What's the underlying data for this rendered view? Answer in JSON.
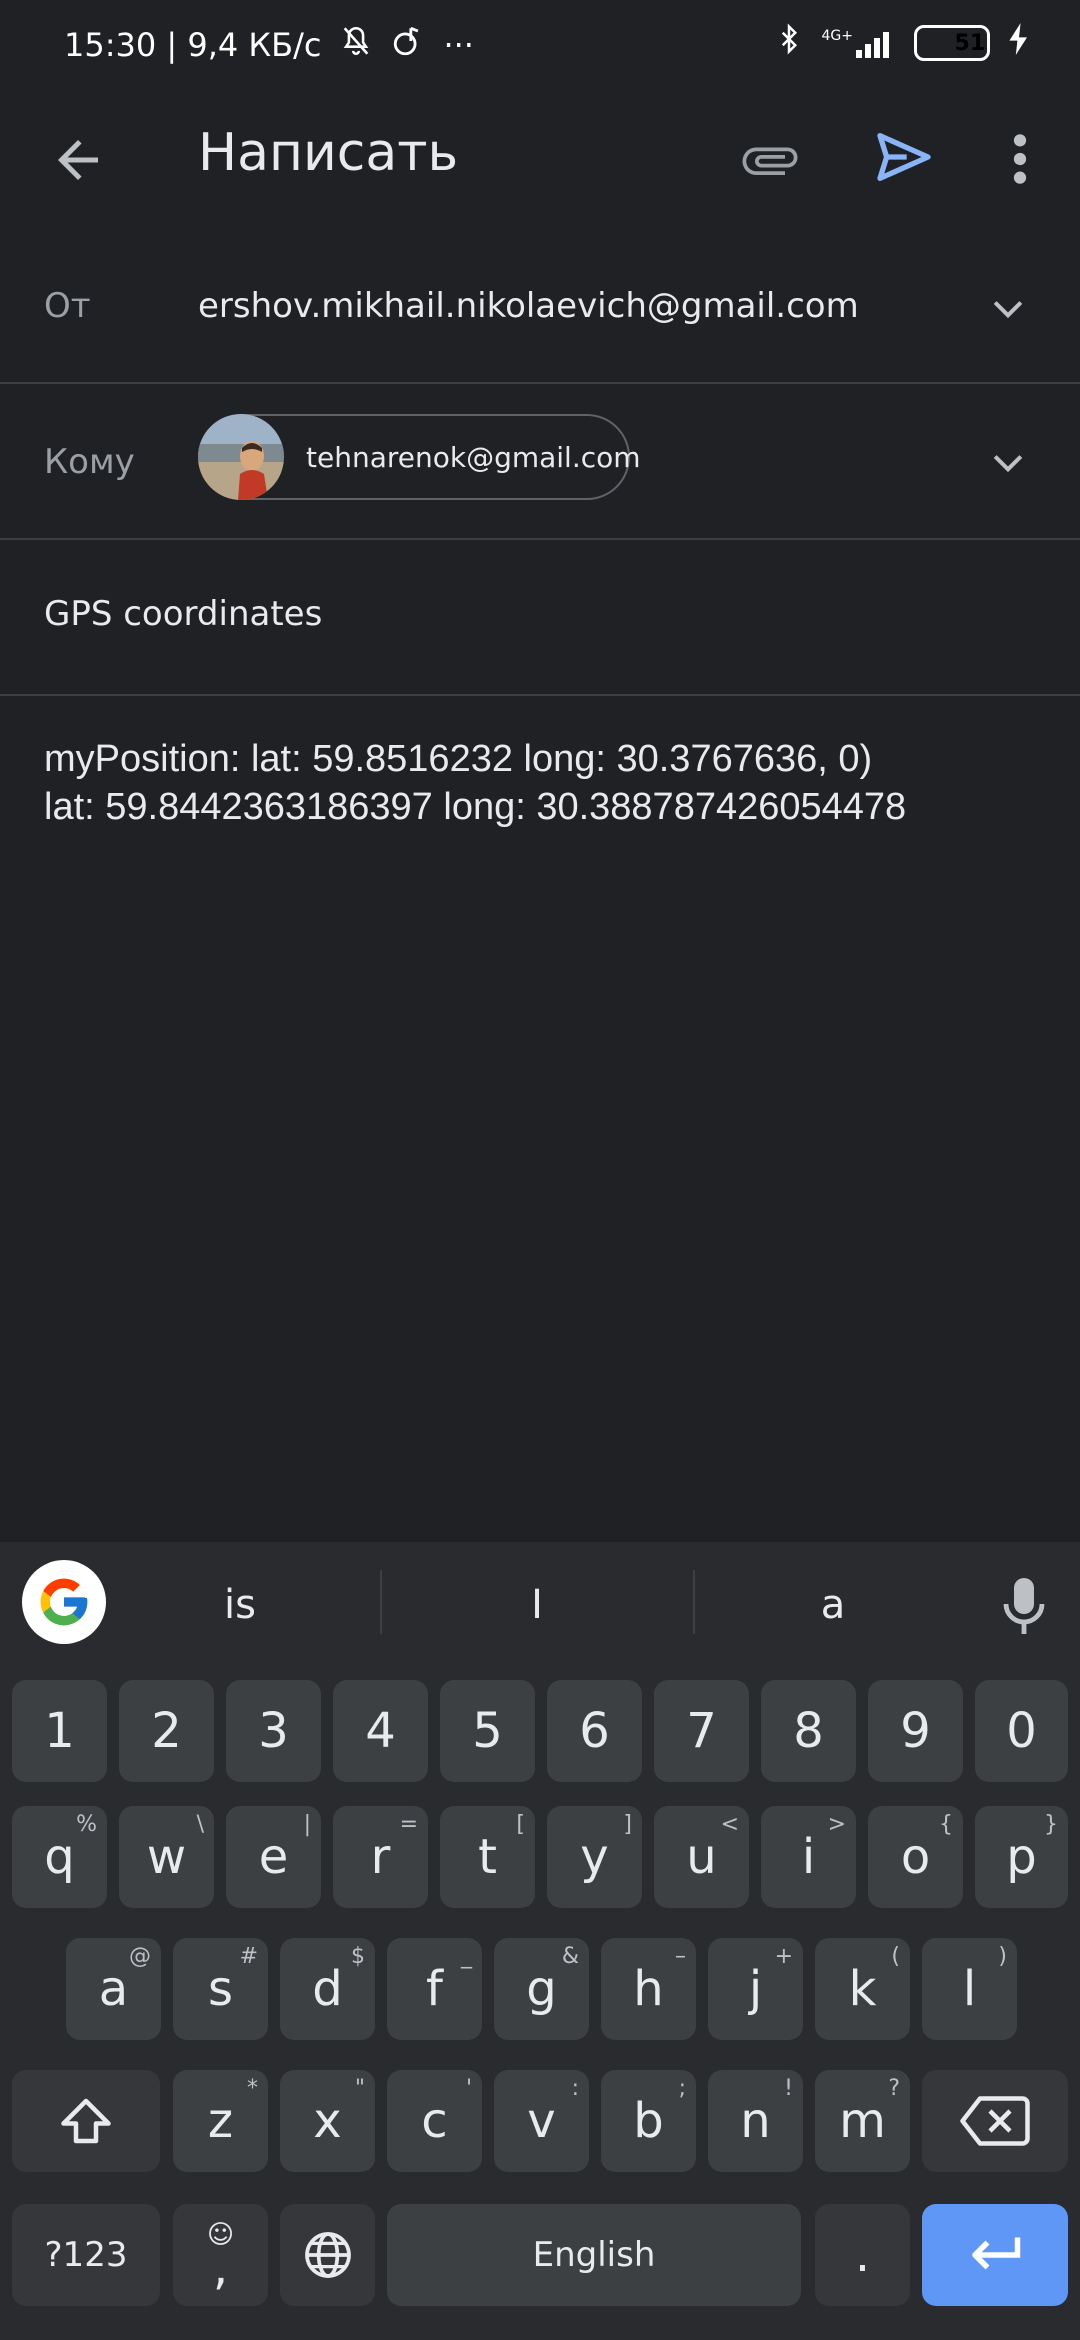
{
  "status": {
    "time_speed": "15:30 | 9,4 КБ/с",
    "more_dots": "···",
    "network": "4G+",
    "battery": "51"
  },
  "appbar": {
    "title": "Написать"
  },
  "from": {
    "label": "От",
    "value": "ershov.mikhail.nikolaevich@gmail.com"
  },
  "to": {
    "label": "Кому",
    "chip_email": "tehnarenok@gmail.com"
  },
  "subject": {
    "value": "GPS coordinates"
  },
  "body": {
    "line1": "myPosition: lat: 59.8516232 long: 30.3767636, 0)",
    "line2": "lat: 59.8442363186397 long: 30.388787426054478"
  },
  "keyboard": {
    "suggestions": [
      "is",
      "I",
      "a"
    ],
    "row_numbers": [
      "1",
      "2",
      "3",
      "4",
      "5",
      "6",
      "7",
      "8",
      "9",
      "0"
    ],
    "row1": [
      {
        "key": "q",
        "sup": "%"
      },
      {
        "key": "w",
        "sup": "\\"
      },
      {
        "key": "e",
        "sup": "|"
      },
      {
        "key": "r",
        "sup": "="
      },
      {
        "key": "t",
        "sup": "["
      },
      {
        "key": "y",
        "sup": "]"
      },
      {
        "key": "u",
        "sup": "<"
      },
      {
        "key": "i",
        "sup": ">"
      },
      {
        "key": "o",
        "sup": "{"
      },
      {
        "key": "p",
        "sup": "}"
      }
    ],
    "row2": [
      {
        "key": "a",
        "sup": "@"
      },
      {
        "key": "s",
        "sup": "#"
      },
      {
        "key": "d",
        "sup": "$"
      },
      {
        "key": "f",
        "sup": "_"
      },
      {
        "key": "g",
        "sup": "&"
      },
      {
        "key": "h",
        "sup": "–"
      },
      {
        "key": "j",
        "sup": "+"
      },
      {
        "key": "k",
        "sup": "("
      },
      {
        "key": "l",
        "sup": ")"
      }
    ],
    "row3": [
      {
        "key": "z",
        "sup": "*"
      },
      {
        "key": "x",
        "sup": "\""
      },
      {
        "key": "c",
        "sup": "'"
      },
      {
        "key": "v",
        "sup": ":"
      },
      {
        "key": "b",
        "sup": ";"
      },
      {
        "key": "n",
        "sup": "!"
      },
      {
        "key": "m",
        "sup": "?"
      }
    ],
    "sym_label": "?123",
    "comma": ",",
    "space_label": "English",
    "period": "."
  },
  "colors": {
    "background": "#202124",
    "accent_send": "#8ab4f8",
    "enter_key": "#5e97f6"
  }
}
